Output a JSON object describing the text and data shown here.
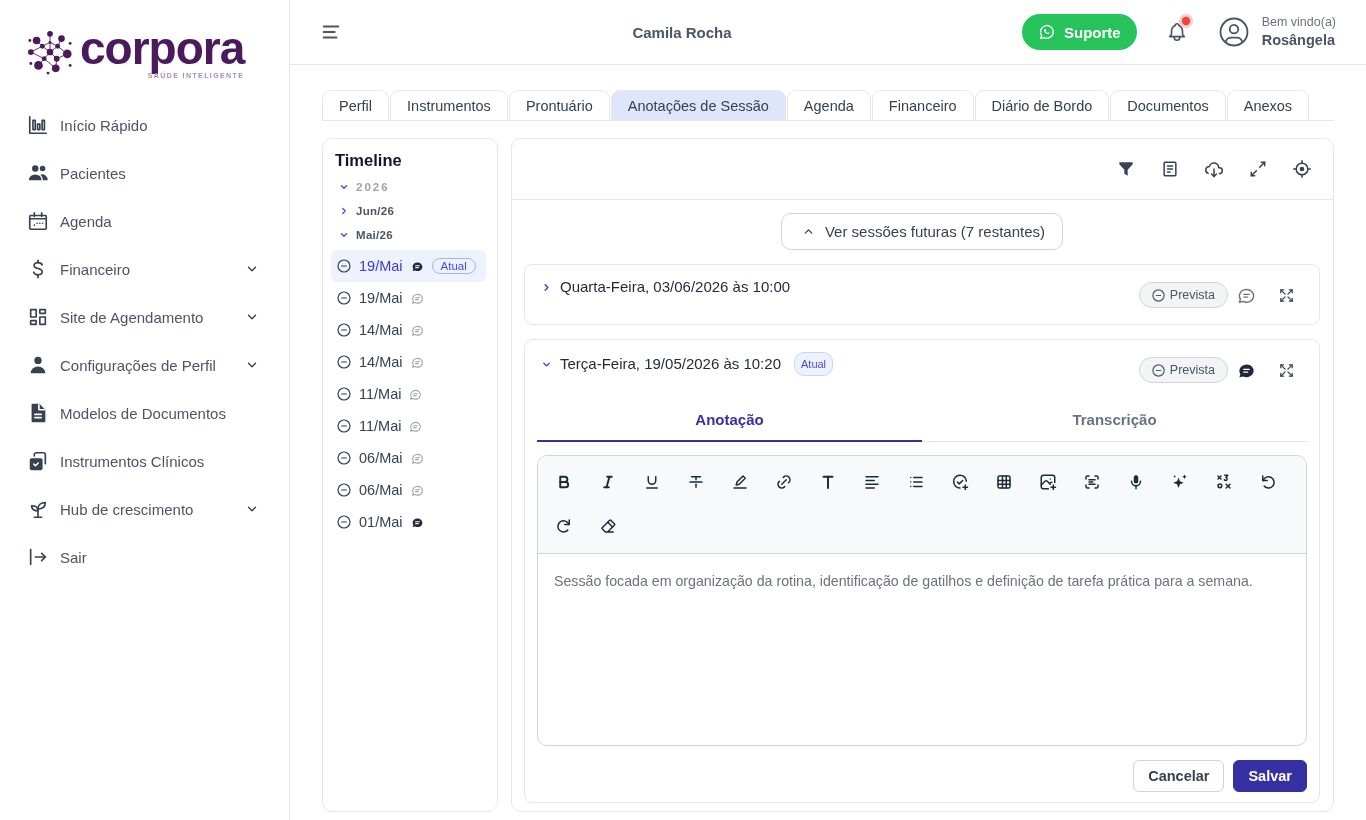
{
  "sidebar": {
    "logo": {
      "wordmark": "corpora",
      "tagline": "SAÚDE INTELIGENTE"
    },
    "items": [
      {
        "label": "Início Rápido",
        "has_submenu": false
      },
      {
        "label": "Pacientes",
        "has_submenu": false
      },
      {
        "label": "Agenda",
        "has_submenu": false
      },
      {
        "label": "Financeiro",
        "has_submenu": true
      },
      {
        "label": "Site de Agendamento",
        "has_submenu": true
      },
      {
        "label": "Configurações de Perfil",
        "has_submenu": true
      },
      {
        "label": "Modelos de Documentos",
        "has_submenu": false
      },
      {
        "label": "Instrumentos Clínicos",
        "has_submenu": false
      },
      {
        "label": "Hub de crescimento",
        "has_submenu": true
      },
      {
        "label": "Sair",
        "has_submenu": false
      }
    ]
  },
  "header": {
    "title": "Camila Rocha",
    "support_button": "Suporte",
    "notifications": {
      "unread": true
    },
    "user": {
      "greeting": "Bem vindo(a)",
      "name": "Rosângela"
    }
  },
  "tabs": [
    {
      "label": "Perfil",
      "selected": false
    },
    {
      "label": "Instrumentos",
      "selected": false
    },
    {
      "label": "Prontuário",
      "selected": false
    },
    {
      "label": "Anotações de Sessão",
      "selected": true
    },
    {
      "label": "Agenda",
      "selected": false
    },
    {
      "label": "Financeiro",
      "selected": false
    },
    {
      "label": "Diário de Bordo",
      "selected": false
    },
    {
      "label": "Documentos",
      "selected": false
    },
    {
      "label": "Anexos",
      "selected": false
    }
  ],
  "timeline": {
    "title": "Timeline",
    "years": [
      {
        "label": "2026",
        "expanded": true,
        "children": [
          {
            "label": "Jun/26",
            "expanded": false
          },
          {
            "label": "Mai/26",
            "expanded": true,
            "children": [
              {
                "label": "19/Mai",
                "selected": true,
                "note": true,
                "badge": "Atual"
              },
              {
                "label": "19/Mai",
                "selected": false,
                "note": false
              },
              {
                "label": "14/Mai",
                "selected": false,
                "note": false
              },
              {
                "label": "14/Mai",
                "selected": false,
                "note": false
              },
              {
                "label": "11/Mai",
                "selected": false,
                "note": false
              },
              {
                "label": "11/Mai",
                "selected": false,
                "note": false
              },
              {
                "label": "06/Mai",
                "selected": false,
                "note": false
              },
              {
                "label": "06/Mai",
                "selected": false,
                "note": false
              },
              {
                "label": "01/Mai",
                "selected": false,
                "note": true
              }
            ]
          }
        ]
      }
    ]
  },
  "sessions_panel": {
    "future_button": "Ver sessões futuras (7 restantes)",
    "sessions": [
      {
        "title": "Quarta-Feira, 03/06/2026 às 10:00",
        "expanded": false,
        "status": "Prevista",
        "note": false
      },
      {
        "title": "Terça-Feira, 19/05/2026 às 10:20",
        "badge": "Atual",
        "expanded": true,
        "status": "Prevista",
        "note": true,
        "editor": {
          "tabs": [
            {
              "label": "Anotação",
              "selected": true
            },
            {
              "label": "Transcrição",
              "selected": false
            }
          ],
          "content": "Sessão focada em organização da rotina, identificação de gatilhos e definição de tarefa prática para a semana.",
          "buttons": [
            {
              "label": "Cancelar",
              "kind": "secondary"
            },
            {
              "label": "Salvar",
              "kind": "primary"
            }
          ]
        }
      }
    ]
  }
}
